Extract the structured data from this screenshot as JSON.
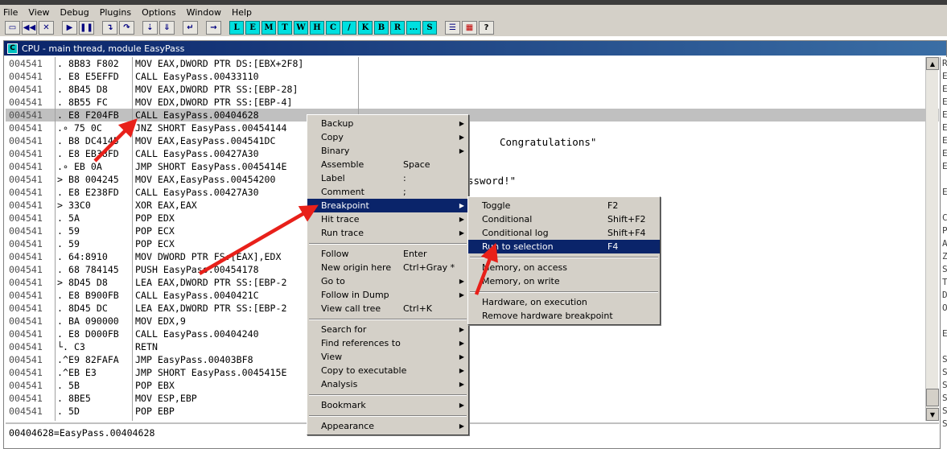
{
  "menu": [
    "File",
    "View",
    "Debug",
    "Plugins",
    "Options",
    "Window",
    "Help"
  ],
  "toolbar": {
    "icon_buttons": [
      "open-icon",
      "rewind-icon",
      "close-icon",
      "run-icon",
      "pause-icon",
      "step-into-icon",
      "step-over-icon",
      "trace-into-icon",
      "trace-over-icon",
      "execute-till-return-icon",
      "go-to-icon"
    ],
    "letter_buttons": [
      "L",
      "E",
      "M",
      "T",
      "W",
      "H",
      "C",
      "/",
      "K",
      "B",
      "R",
      "...",
      "S"
    ],
    "right_icon_buttons": [
      "list-icon",
      "grid-icon",
      "help-icon"
    ]
  },
  "cpu_window": {
    "title": "CPU - main thread, module EasyPass"
  },
  "disasm": [
    {
      "addr": "004541",
      "hex": ". 8B83 F802",
      "asm": "MOV EAX,DWORD PTR DS:[EBX+2F8]"
    },
    {
      "addr": "004541",
      "hex": ". E8 E5EFFD",
      "asm": "CALL EasyPass.00433110"
    },
    {
      "addr": "004541",
      "hex": ". 8B45 D8",
      "asm": "MOV EAX,DWORD PTR SS:[EBP-28]"
    },
    {
      "addr": "004541",
      "hex": ". 8B55 FC",
      "asm": "MOV EDX,DWORD PTR SS:[EBP-4]"
    },
    {
      "addr": "004541",
      "hex": ". E8 F204FB",
      "asm": "CALL EasyPass.00404628"
    },
    {
      "addr": "004541",
      "hex": ".∘ 75 0C",
      "asm": "JNZ SHORT EasyPass.00454144"
    },
    {
      "addr": "004541",
      "hex": ". B8 DC4145",
      "asm": "MOV EAX,EasyPass.004541DC"
    },
    {
      "addr": "004541",
      "hex": ". E8 EB38FD",
      "asm": "CALL EasyPass.00427A30"
    },
    {
      "addr": "004541",
      "hex": ".∘ EB 0A",
      "asm": "JMP SHORT EasyPass.0045414E"
    },
    {
      "addr": "004541",
      "hex": "> B8 004245",
      "asm": "MOV EAX,EasyPass.00454200"
    },
    {
      "addr": "004541",
      "hex": ". E8 E238FD",
      "asm": "CALL EasyPass.00427A30"
    },
    {
      "addr": "004541",
      "hex": "> 33C0",
      "asm": "XOR EAX,EAX"
    },
    {
      "addr": "004541",
      "hex": ". 5A",
      "asm": "POP EDX"
    },
    {
      "addr": "004541",
      "hex": ". 59",
      "asm": "POP ECX"
    },
    {
      "addr": "004541",
      "hex": ". 59",
      "asm": "POP ECX"
    },
    {
      "addr": "004541",
      "hex": ". 64:8910",
      "asm": "MOV DWORD PTR FS:[EAX],EDX"
    },
    {
      "addr": "004541",
      "hex": ". 68 784145",
      "asm": "PUSH EasyPass.00454178"
    },
    {
      "addr": "004541",
      "hex": "> 8D45 D8",
      "asm": "LEA EAX,DWORD PTR SS:[EBP-2"
    },
    {
      "addr": "004541",
      "hex": ". E8 B900FB",
      "asm": "CALL EasyPass.0040421C"
    },
    {
      "addr": "004541",
      "hex": ". 8D45 DC",
      "asm": "LEA EAX,DWORD PTR SS:[EBP-2"
    },
    {
      "addr": "004541",
      "hex": ". BA 090000",
      "asm": "MOV EDX,9"
    },
    {
      "addr": "004541",
      "hex": ". E8 D000FB",
      "asm": "CALL EasyPass.00404240"
    },
    {
      "addr": "004541",
      "hex": "└. C3",
      "asm": "RETN"
    },
    {
      "addr": "004541",
      "hex": ".^E9 82FAFA",
      "asm": "JMP EasyPass.00403BF8"
    },
    {
      "addr": "004541",
      "hex": ".^EB E3",
      "asm": "JMP SHORT EasyPass.0045415E"
    },
    {
      "addr": "004541",
      "hex": ". 5B",
      "asm": "POP EBX"
    },
    {
      "addr": "004541",
      "hex": ". 8BE5",
      "asm": "MOV ESP,EBP"
    },
    {
      "addr": "004541",
      "hex": ". 5D",
      "asm": "POP EBP"
    }
  ],
  "comments": {
    "congrats": "Congratulations\"",
    "password": "ssword!\""
  },
  "info_line": "00404628=EasyPass.00404628",
  "registers_letters": [
    "R",
    "E",
    "E",
    "E",
    "E",
    "E",
    "E",
    "E",
    "E",
    "",
    "E",
    "",
    "C",
    "P",
    "A",
    "Z",
    "S",
    "T",
    "D",
    "O",
    "",
    "E",
    "",
    "S",
    "S",
    "S",
    "S",
    "S",
    "S"
  ],
  "context_menu": [
    {
      "label": "Backup",
      "submenu": true
    },
    {
      "label": "Copy",
      "submenu": true
    },
    {
      "label": "Binary",
      "submenu": true
    },
    {
      "label": "Assemble",
      "shortcut": "Space"
    },
    {
      "label": "Label",
      "shortcut": ":"
    },
    {
      "label": "Comment",
      "shortcut": ";"
    },
    {
      "label": "Breakpoint",
      "submenu": true,
      "highlighted": true
    },
    {
      "label": "Hit trace",
      "submenu": true
    },
    {
      "label": "Run trace",
      "submenu": true
    },
    {
      "separator": true
    },
    {
      "label": "Follow",
      "shortcut": "Enter"
    },
    {
      "label": "New origin here",
      "shortcut": "Ctrl+Gray *"
    },
    {
      "label": "Go to",
      "submenu": true
    },
    {
      "label": "Follow in Dump",
      "submenu": true
    },
    {
      "label": "View call tree",
      "shortcut": "Ctrl+K"
    },
    {
      "separator": true
    },
    {
      "label": "Search for",
      "submenu": true
    },
    {
      "label": "Find references to",
      "submenu": true
    },
    {
      "label": "View",
      "submenu": true
    },
    {
      "label": "Copy to executable",
      "submenu": true
    },
    {
      "label": "Analysis",
      "submenu": true
    },
    {
      "separator": true
    },
    {
      "label": "Bookmark",
      "submenu": true
    },
    {
      "separator": true
    },
    {
      "label": "Appearance",
      "submenu": true
    }
  ],
  "breakpoint_submenu": [
    {
      "label": "Toggle",
      "shortcut": "F2"
    },
    {
      "label": "Conditional",
      "shortcut": "Shift+F2"
    },
    {
      "label": "Conditional log",
      "shortcut": "Shift+F4"
    },
    {
      "label": "Run to selection",
      "shortcut": "F4",
      "highlighted": true
    },
    {
      "separator": true
    },
    {
      "label": "Memory, on access"
    },
    {
      "label": "Memory, on write"
    },
    {
      "separator": true
    },
    {
      "label": "Hardware, on execution"
    },
    {
      "label": "Remove hardware breakpoint"
    }
  ],
  "colors": {
    "title_bar": "#0a246a",
    "menu_highlight": "#0a246a",
    "arrow": "#e8201a",
    "toolbar_letter": "#00e0e0",
    "selected_row": "#c0c0c0"
  }
}
